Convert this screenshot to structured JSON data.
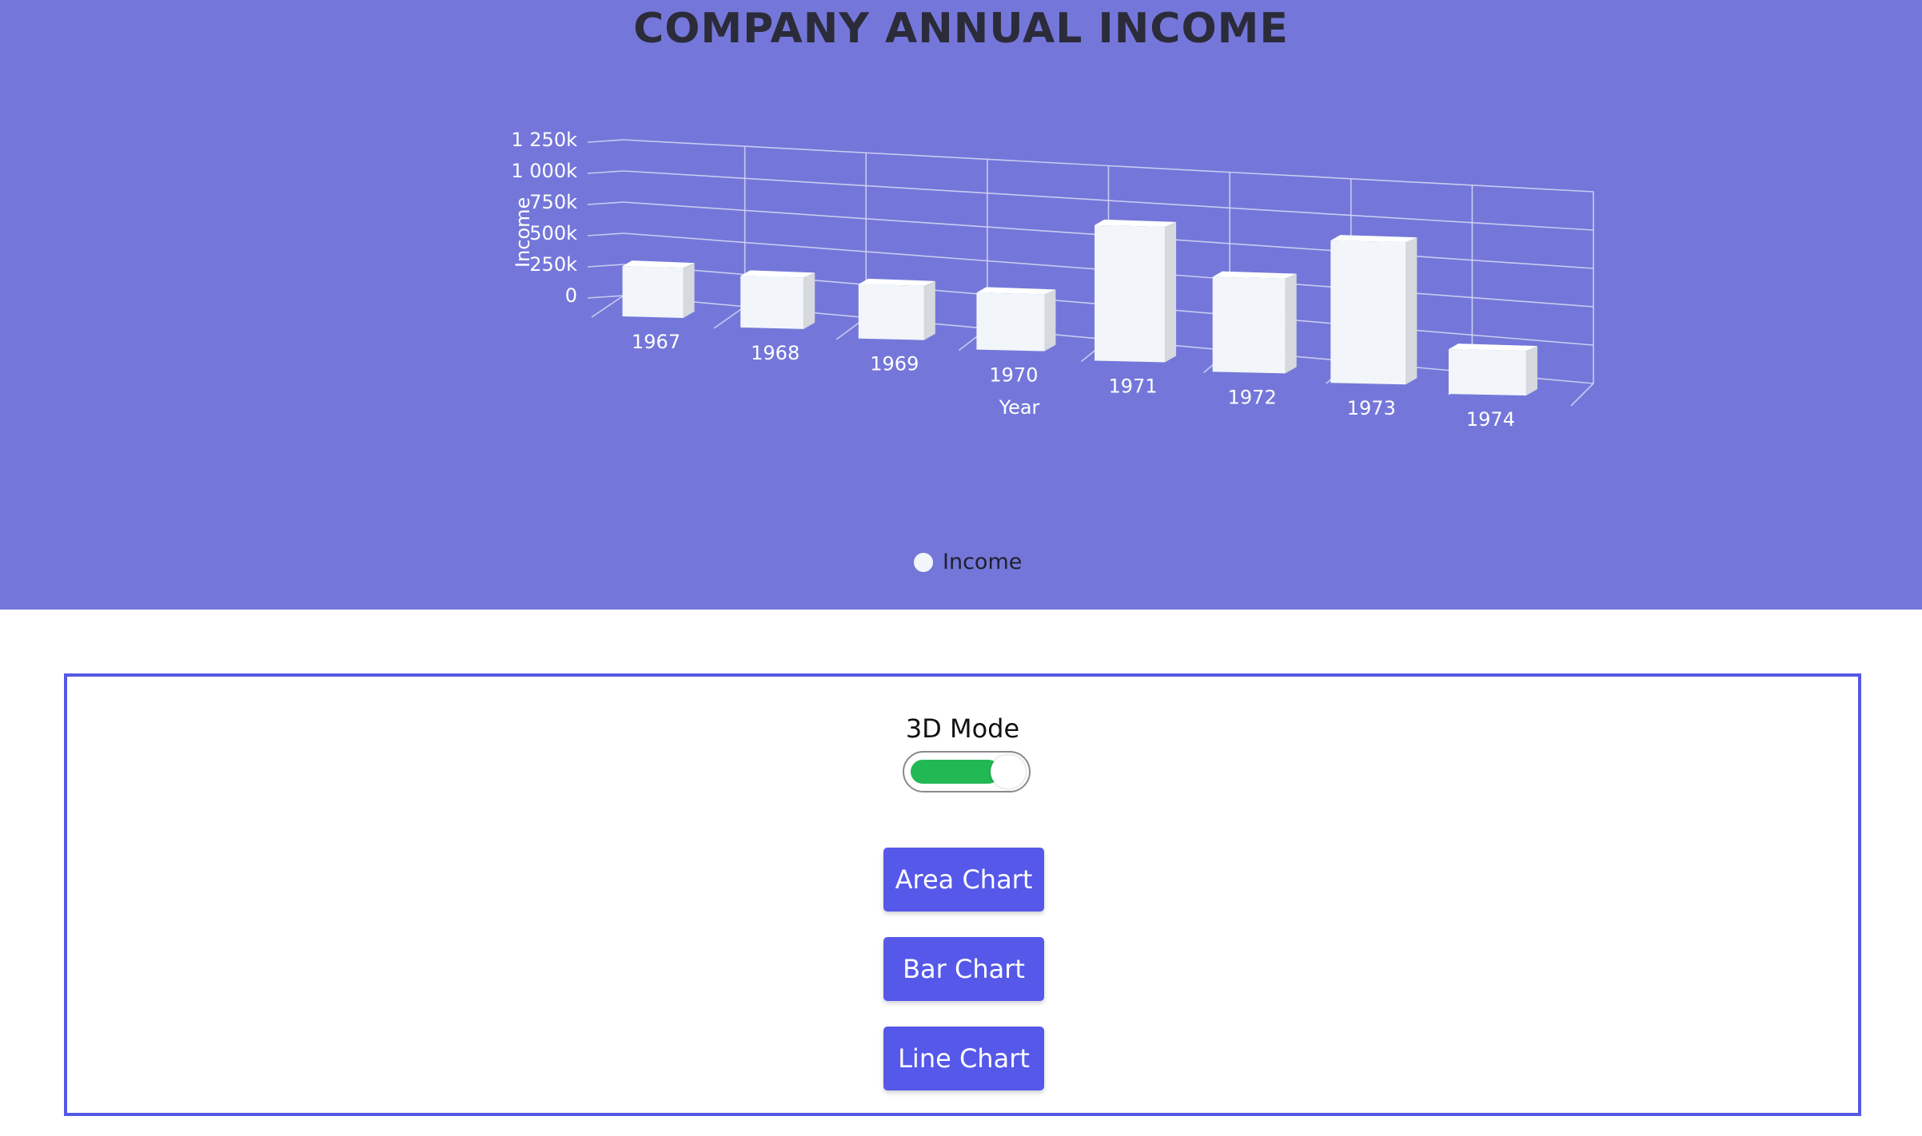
{
  "chart_data": {
    "type": "bar",
    "title": "COMPANY ANNUAL INCOME",
    "xlabel": "Year",
    "ylabel": "Income",
    "categories": [
      "1967",
      "1968",
      "1969",
      "1970",
      "1971",
      "1972",
      "1973",
      "1974"
    ],
    "series": [
      {
        "name": "Income",
        "values": [
          370000,
          380000,
          400000,
          420000,
          1000000,
          700000,
          1050000,
          330000
        ]
      }
    ],
    "ylim": [
      0,
      1250000
    ],
    "yticks": [
      {
        "value": 0,
        "label": "0"
      },
      {
        "value": 250000,
        "label": "250k"
      },
      {
        "value": 500000,
        "label": "500k"
      },
      {
        "value": 750000,
        "label": "750k"
      },
      {
        "value": 1000000,
        "label": "1 000k"
      },
      {
        "value": 1250000,
        "label": "1 250k"
      }
    ],
    "three_d": true,
    "grid": true,
    "legend_position": "bottom-center",
    "colors": {
      "panel_bg": "#7477d9",
      "bar_front": "#f2f6fa",
      "bar_side": "#d6d9dd",
      "bar_top": "#ffffff"
    }
  },
  "legend": {
    "label": "Income"
  },
  "controls": {
    "mode_label": "3D Mode",
    "mode_enabled": true,
    "accent": "#22b854",
    "buttons": [
      {
        "label": "Area Chart"
      },
      {
        "label": "Bar Chart"
      },
      {
        "label": "Line Chart"
      }
    ]
  }
}
